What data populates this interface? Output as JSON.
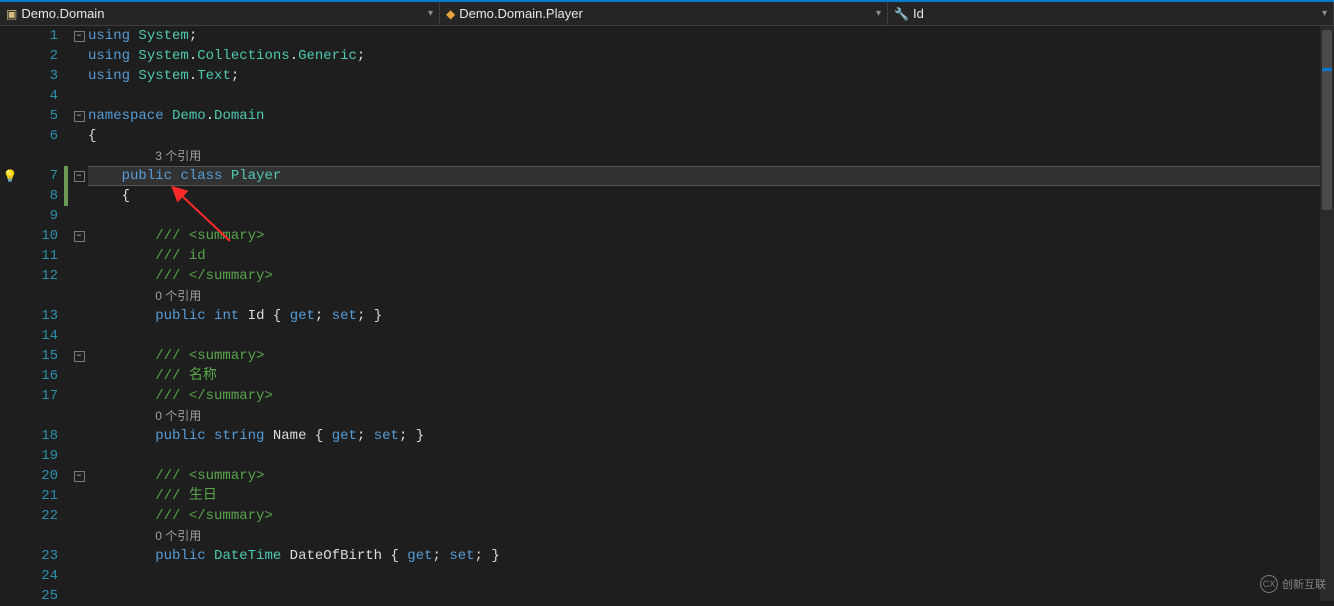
{
  "breadcrumbs": {
    "namespace": "Demo.Domain",
    "class": "Demo.Domain.Player",
    "member": "Id"
  },
  "colors": {
    "bg": "#1e1e1e",
    "keyword": "#569cd6",
    "type": "#4ec9b0",
    "comment": "#57a64a",
    "linenum": "#2b91af"
  },
  "code": {
    "lines": [
      {
        "n": 1,
        "fold": "minus",
        "segments": [
          {
            "t": "kw",
            "x": "using"
          },
          {
            "t": "pln",
            "x": " "
          },
          {
            "t": "typ",
            "x": "System"
          },
          {
            "t": "pln",
            "x": ";"
          }
        ]
      },
      {
        "n": 2,
        "segments": [
          {
            "t": "kw",
            "x": "using"
          },
          {
            "t": "pln",
            "x": " "
          },
          {
            "t": "typ",
            "x": "System"
          },
          {
            "t": "pln",
            "x": "."
          },
          {
            "t": "typ",
            "x": "Collections"
          },
          {
            "t": "pln",
            "x": "."
          },
          {
            "t": "typ",
            "x": "Generic"
          },
          {
            "t": "pln",
            "x": ";"
          }
        ]
      },
      {
        "n": 3,
        "segments": [
          {
            "t": "kw",
            "x": "using"
          },
          {
            "t": "pln",
            "x": " "
          },
          {
            "t": "typ",
            "x": "System"
          },
          {
            "t": "pln",
            "x": "."
          },
          {
            "t": "typ",
            "x": "Text"
          },
          {
            "t": "pln",
            "x": ";"
          }
        ]
      },
      {
        "n": 4,
        "segments": []
      },
      {
        "n": 5,
        "fold": "minus",
        "segments": [
          {
            "t": "kw",
            "x": "namespace"
          },
          {
            "t": "pln",
            "x": " "
          },
          {
            "t": "typ",
            "x": "Demo"
          },
          {
            "t": "pln",
            "x": "."
          },
          {
            "t": "typ",
            "x": "Domain"
          }
        ]
      },
      {
        "n": 6,
        "segments": [
          {
            "t": "pln",
            "x": "{"
          }
        ]
      },
      {
        "n": "",
        "codelens": true,
        "segments": [
          {
            "t": "ref",
            "x": "3 个引用"
          }
        ]
      },
      {
        "n": 7,
        "fold": "minus",
        "highlight": true,
        "quickfix": true,
        "changed": true,
        "segments": [
          {
            "t": "pln",
            "x": "    "
          },
          {
            "t": "kw",
            "x": "public"
          },
          {
            "t": "pln",
            "x": " "
          },
          {
            "t": "kw",
            "x": "class"
          },
          {
            "t": "pln",
            "x": " "
          },
          {
            "t": "typ",
            "x": "Player"
          }
        ]
      },
      {
        "n": 8,
        "changed": true,
        "segments": [
          {
            "t": "pln",
            "x": "    {"
          }
        ]
      },
      {
        "n": 9,
        "segments": []
      },
      {
        "n": 10,
        "fold": "minus",
        "segments": [
          {
            "t": "pln",
            "x": "        "
          },
          {
            "t": "doc",
            "x": "/// <summary>"
          }
        ]
      },
      {
        "n": 11,
        "segments": [
          {
            "t": "pln",
            "x": "        "
          },
          {
            "t": "doc",
            "x": "/// id"
          }
        ]
      },
      {
        "n": 12,
        "segments": [
          {
            "t": "pln",
            "x": "        "
          },
          {
            "t": "doc",
            "x": "/// </summary>"
          }
        ]
      },
      {
        "n": "",
        "codelens": true,
        "segments": [
          {
            "t": "ref",
            "x": "0 个引用"
          }
        ]
      },
      {
        "n": 13,
        "segments": [
          {
            "t": "pln",
            "x": "        "
          },
          {
            "t": "kw",
            "x": "public"
          },
          {
            "t": "pln",
            "x": " "
          },
          {
            "t": "kw",
            "x": "int"
          },
          {
            "t": "pln",
            "x": " Id { "
          },
          {
            "t": "kw",
            "x": "get"
          },
          {
            "t": "pln",
            "x": "; "
          },
          {
            "t": "kw",
            "x": "set"
          },
          {
            "t": "pln",
            "x": "; }"
          }
        ]
      },
      {
        "n": 14,
        "segments": []
      },
      {
        "n": 15,
        "fold": "minus",
        "segments": [
          {
            "t": "pln",
            "x": "        "
          },
          {
            "t": "doc",
            "x": "/// <summary>"
          }
        ]
      },
      {
        "n": 16,
        "segments": [
          {
            "t": "pln",
            "x": "        "
          },
          {
            "t": "doc",
            "x": "/// 名称"
          }
        ]
      },
      {
        "n": 17,
        "segments": [
          {
            "t": "pln",
            "x": "        "
          },
          {
            "t": "doc",
            "x": "/// </summary>"
          }
        ]
      },
      {
        "n": "",
        "codelens": true,
        "segments": [
          {
            "t": "ref",
            "x": "0 个引用"
          }
        ]
      },
      {
        "n": 18,
        "segments": [
          {
            "t": "pln",
            "x": "        "
          },
          {
            "t": "kw",
            "x": "public"
          },
          {
            "t": "pln",
            "x": " "
          },
          {
            "t": "kw",
            "x": "string"
          },
          {
            "t": "pln",
            "x": " Name { "
          },
          {
            "t": "kw",
            "x": "get"
          },
          {
            "t": "pln",
            "x": "; "
          },
          {
            "t": "kw",
            "x": "set"
          },
          {
            "t": "pln",
            "x": "; }"
          }
        ]
      },
      {
        "n": 19,
        "segments": []
      },
      {
        "n": 20,
        "fold": "minus",
        "segments": [
          {
            "t": "pln",
            "x": "        "
          },
          {
            "t": "doc",
            "x": "/// <summary>"
          }
        ]
      },
      {
        "n": 21,
        "segments": [
          {
            "t": "pln",
            "x": "        "
          },
          {
            "t": "doc",
            "x": "/// 生日"
          }
        ]
      },
      {
        "n": 22,
        "segments": [
          {
            "t": "pln",
            "x": "        "
          },
          {
            "t": "doc",
            "x": "/// </summary>"
          }
        ]
      },
      {
        "n": "",
        "codelens": true,
        "segments": [
          {
            "t": "ref",
            "x": "0 个引用"
          }
        ]
      },
      {
        "n": 23,
        "segments": [
          {
            "t": "pln",
            "x": "        "
          },
          {
            "t": "kw",
            "x": "public"
          },
          {
            "t": "pln",
            "x": " "
          },
          {
            "t": "typ",
            "x": "DateTime"
          },
          {
            "t": "pln",
            "x": " DateOfBirth { "
          },
          {
            "t": "kw",
            "x": "get"
          },
          {
            "t": "pln",
            "x": "; "
          },
          {
            "t": "kw",
            "x": "set"
          },
          {
            "t": "pln",
            "x": "; }"
          }
        ]
      },
      {
        "n": 24,
        "segments": []
      },
      {
        "n": 25,
        "segments": []
      }
    ]
  },
  "watermark": "创新互联"
}
